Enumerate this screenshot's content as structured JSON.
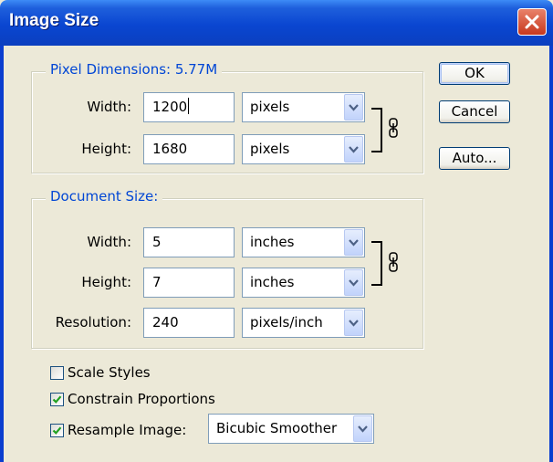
{
  "window": {
    "title": "Image Size"
  },
  "pixel_dimensions": {
    "legend": "Pixel Dimensions:  5.77M",
    "width": {
      "label": "Width:",
      "value": "1200",
      "unit": "pixels"
    },
    "height": {
      "label": "Height:",
      "value": "1680",
      "unit": "pixels"
    }
  },
  "document_size": {
    "legend": "Document Size:",
    "width": {
      "label": "Width:",
      "value": "5",
      "unit": "inches"
    },
    "height": {
      "label": "Height:",
      "value": "7",
      "unit": "inches"
    },
    "resolution": {
      "label": "Resolution:",
      "value": "240",
      "unit": "pixels/inch"
    }
  },
  "options": {
    "scale_styles": {
      "label": "Scale Styles",
      "checked": false
    },
    "constrain_proportions": {
      "label": "Constrain Proportions",
      "checked": true
    },
    "resample_image": {
      "label": "Resample Image:",
      "checked": true,
      "method": "Bicubic Smoother"
    }
  },
  "buttons": {
    "ok": "OK",
    "cancel": "Cancel",
    "auto": "Auto..."
  },
  "colors": {
    "title_bar": "#0a46d1",
    "legend_text": "#0046d5",
    "dialog_bg": "#ece9d8",
    "check_mark": "#21a121"
  }
}
